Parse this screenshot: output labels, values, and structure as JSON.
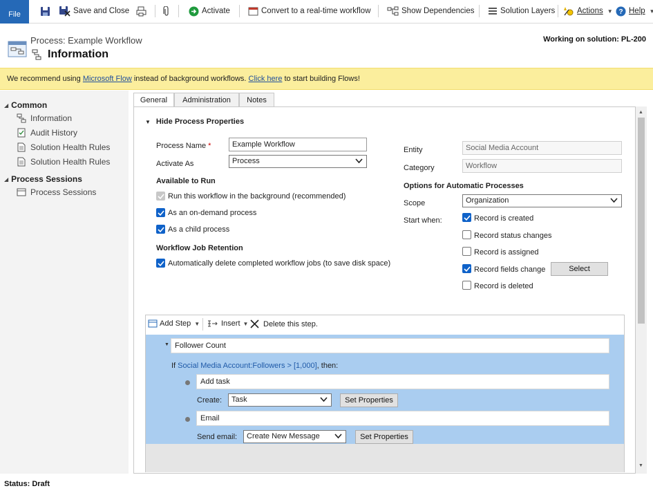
{
  "ribbon": {
    "file": "File",
    "save_close": "Save and Close",
    "activate": "Activate",
    "convert": "Convert to a real-time workflow",
    "show_dependencies": "Show Dependencies",
    "solution_layers": "Solution Layers",
    "actions": "Actions",
    "help": "Help"
  },
  "header": {
    "entity_title": "Process: Example Workflow",
    "page_title": "Information",
    "solution": "Working on solution: PL-200"
  },
  "notice": {
    "prefix": "We recommend using ",
    "link1": "Microsoft Flow",
    "middle": " instead of background workflows. ",
    "link2": "Click here",
    "suffix": " to start building Flows!"
  },
  "nav": {
    "group1": "Common",
    "items1": [
      "Information",
      "Audit History",
      "Solution Health Rules",
      "Solution Health Rules"
    ],
    "group2": "Process Sessions",
    "items2": [
      "Process Sessions"
    ]
  },
  "tabs": [
    "General",
    "Administration",
    "Notes"
  ],
  "section": {
    "title": "Hide Process Properties",
    "process_name_label": "Process Name",
    "process_name_value": "Example Workflow",
    "activate_as_label": "Activate As",
    "activate_as_value": "Process",
    "available_heading": "Available to Run",
    "opt_background": "Run this workflow in the background (recommended)",
    "opt_ondemand": "As an on-demand process",
    "opt_child": "As a child process",
    "retention_heading": "Workflow Job Retention",
    "opt_autodelete": "Automatically delete completed workflow jobs (to save disk space)",
    "entity_label": "Entity",
    "entity_value": "Social Media Account",
    "category_label": "Category",
    "category_value": "Workflow",
    "auto_heading": "Options for Automatic Processes",
    "scope_label": "Scope",
    "scope_value": "Organization",
    "start_label": "Start when:",
    "start_options": [
      "Record is created",
      "Record status changes",
      "Record is assigned",
      "Record fields change",
      "Record is deleted"
    ],
    "start_checked": [
      true,
      false,
      false,
      true,
      false
    ],
    "select_button": "Select"
  },
  "designer": {
    "add_step": "Add Step",
    "insert": "Insert",
    "delete": "Delete this step.",
    "step_title": "Follower Count",
    "cond_if": "If ",
    "cond_link": "Social Media Account:Followers > [1,000]",
    "cond_then": ", then:",
    "step1": "Add task",
    "create_label": "Create:",
    "create_value": "Task",
    "step2": "Email",
    "send_label": "Send email:",
    "send_value": "Create New Message",
    "set_properties": "Set Properties"
  },
  "status": "Status: Draft",
  "colors": {
    "accent": "#2569b7",
    "notice_bg": "#fbee9d",
    "designer_bg": "#aacdf0",
    "checkbox": "#0f62c9"
  }
}
